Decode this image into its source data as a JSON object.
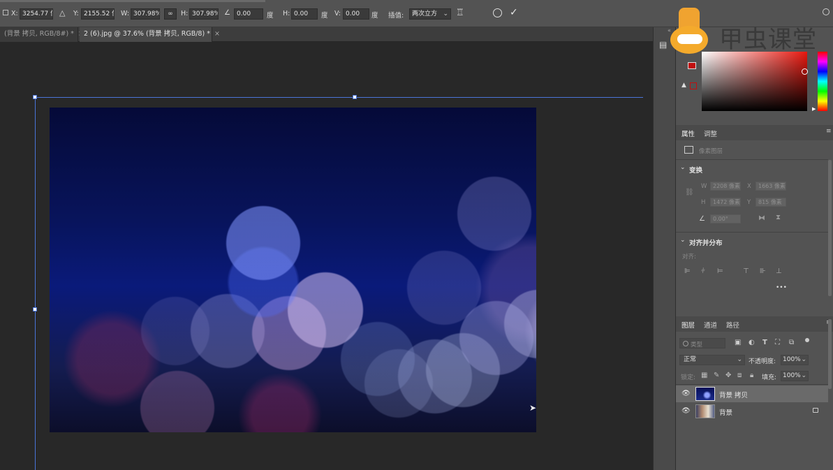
{
  "options_bar": {
    "x_label": "X:",
    "x_value": "3254.77 像",
    "y_label": "Y:",
    "y_value": "2155.52 像",
    "w_label": "W:",
    "w_value": "307.98%",
    "h_label": "H:",
    "h_value": "307.98%",
    "angle_value": "0.00",
    "angle_unit": "度",
    "hskew_label": "H:",
    "hskew_value": "0.00",
    "hskew_unit": "度",
    "vskew_label": "V:",
    "vskew_value": "0.00",
    "vskew_unit": "度",
    "interp_label": "插值:",
    "interp_value": "两次立方"
  },
  "tabs": [
    {
      "label": "(背景 拷贝, RGB/8#) *",
      "close": "×"
    },
    {
      "label": "2 (6).jpg @ 37.6% (背景 拷贝, RGB/8) *",
      "close": "×"
    }
  ],
  "watermark": {
    "text": "甲虫课堂"
  },
  "properties": {
    "tab_properties": "属性",
    "tab_adjust": "调整",
    "layer_kind": "像素图层",
    "transform_title": "变换",
    "w_label": "W",
    "w_value": "2208 像素",
    "x_label": "X",
    "x_value": "1663 像素",
    "h_label": "H",
    "h_value": "1472 像素",
    "y_label": "Y",
    "y_value": "815 像素",
    "angle_value": "0.00°",
    "align_title": "对齐并分布",
    "align_label": "对齐:",
    "more": "•••"
  },
  "layers": {
    "tab_layers": "图层",
    "tab_channels": "通道",
    "tab_paths": "路径",
    "filter_placeholder": "类型",
    "blend_mode": "正常",
    "opacity_label": "不透明度:",
    "opacity_value": "100%",
    "lock_label": "锁定:",
    "fill_label": "填充:",
    "fill_value": "100%",
    "items": [
      {
        "name": "背景 拷贝"
      },
      {
        "name": "背景"
      }
    ]
  },
  "colors": {
    "accent": "#4a74d8",
    "panel": "#535353",
    "canvas": "#282828"
  }
}
